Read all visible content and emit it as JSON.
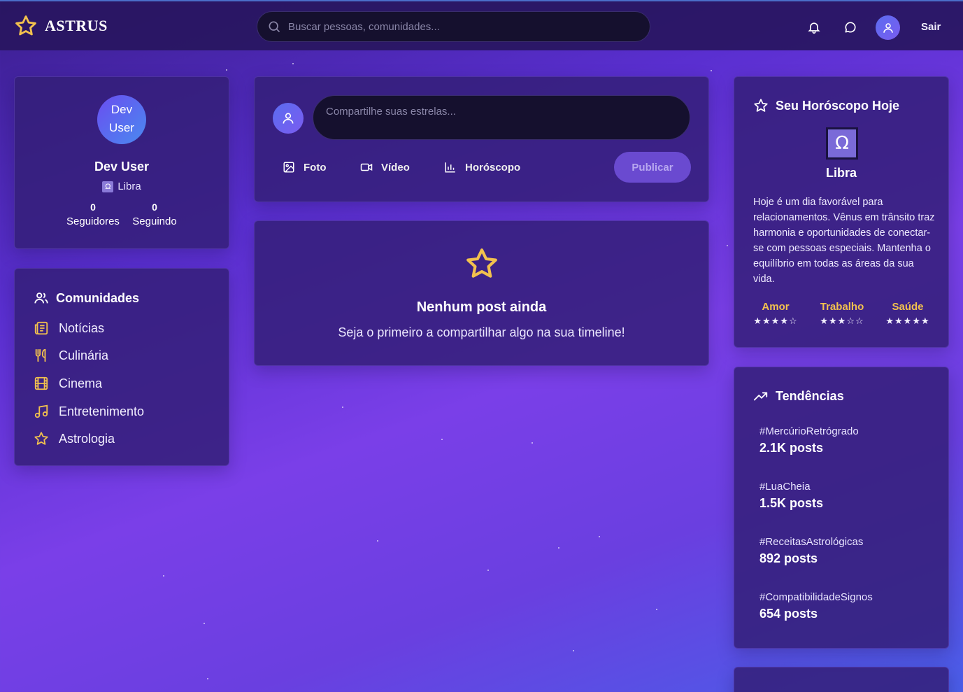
{
  "header": {
    "logo_text": "ASTRUS",
    "search_placeholder": "Buscar pessoas, comunidades...",
    "logout_label": "Sair"
  },
  "profile": {
    "avatar_alt": "Dev User",
    "name": "Dev User",
    "sign": "Libra",
    "followers_count": "0",
    "followers_label": "Seguidores",
    "following_count": "0",
    "following_label": "Seguindo"
  },
  "communities": {
    "title": "Comunidades",
    "items": [
      {
        "label": "Notícias",
        "icon": "newspaper-icon"
      },
      {
        "label": "Culinária",
        "icon": "utensils-icon"
      },
      {
        "label": "Cinema",
        "icon": "film-icon"
      },
      {
        "label": "Entretenimento",
        "icon": "music-icon"
      },
      {
        "label": "Astrologia",
        "icon": "star-icon"
      }
    ]
  },
  "composer": {
    "placeholder": "Compartilhe suas estrelas...",
    "photo_label": "Foto",
    "video_label": "Vídeo",
    "horoscope_label": "Horóscopo",
    "publish_label": "Publicar"
  },
  "empty_feed": {
    "title": "Nenhum post ainda",
    "subtitle": "Seja o primeiro a compartilhar algo na sua timeline!"
  },
  "horoscope": {
    "title": "Seu Horóscopo Hoje",
    "sign_symbol": "Ω",
    "sign": "Libra",
    "text": "Hoje é um dia favorável para relacionamentos. Vênus em trânsito traz harmonia e oportunidades de conectar-se com pessoas especiais. Mantenha o equilíbrio em todas as áreas da sua vida.",
    "ratings": [
      {
        "label": "Amor",
        "stars": "★★★★☆",
        "value": 4
      },
      {
        "label": "Trabalho",
        "stars": "★★★☆☆",
        "value": 3
      },
      {
        "label": "Saúde",
        "stars": "★★★★★",
        "value": 5
      }
    ]
  },
  "trends": {
    "title": "Tendências",
    "items": [
      {
        "tag": "#MercúrioRetrógrado",
        "count": "2.1K posts"
      },
      {
        "tag": "#LuaCheia",
        "count": "1.5K posts"
      },
      {
        "tag": "#ReceitasAstrológicas",
        "count": "892 posts"
      },
      {
        "tag": "#CompatibilidadeSignos",
        "count": "654 posts"
      }
    ]
  },
  "colors": {
    "accent_gold": "#f2c14e",
    "header_bg": "#28165f",
    "card_bg": "#341e78",
    "input_bg": "#15102e"
  }
}
